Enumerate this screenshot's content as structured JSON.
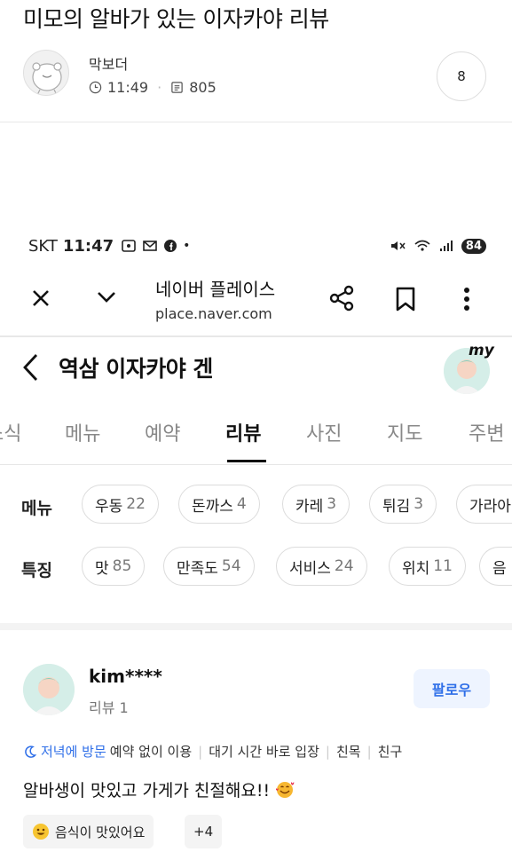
{
  "post": {
    "title": "미모의 알바가 있는 이자카야 리뷰",
    "author": "막보더",
    "time": "11:49",
    "views": "805",
    "comments": "8"
  },
  "status_bar": {
    "carrier": "SKT",
    "time": "11:47",
    "battery": "84"
  },
  "browser": {
    "title": "네이버 플레이스",
    "url": "place.naver.com"
  },
  "place": {
    "name": "역삼 이자카야 겐",
    "my_label": "my"
  },
  "tabs": [
    {
      "label": "소식"
    },
    {
      "label": "메뉴"
    },
    {
      "label": "예약"
    },
    {
      "label": "리뷰"
    },
    {
      "label": "사진"
    },
    {
      "label": "지도"
    },
    {
      "label": "주변"
    }
  ],
  "filters": {
    "menu_label": "메뉴",
    "menu_chips": [
      {
        "name": "우동",
        "count": "22"
      },
      {
        "name": "돈까스",
        "count": "4"
      },
      {
        "name": "카레",
        "count": "3"
      },
      {
        "name": "튀김",
        "count": "3"
      },
      {
        "name": "가라아",
        "count": ""
      }
    ],
    "feature_label": "특징",
    "feature_chips": [
      {
        "name": "맛",
        "count": "85"
      },
      {
        "name": "만족도",
        "count": "54"
      },
      {
        "name": "서비스",
        "count": "24"
      },
      {
        "name": "위치",
        "count": "11"
      },
      {
        "name": "음",
        "count": ""
      }
    ]
  },
  "review": {
    "user": "kim****",
    "reviews": "리뷰 1",
    "follow": "팔로우",
    "visit_time": "저녁에 방문",
    "tags": [
      "예약 없이 이용",
      "대기 시간 바로 입장",
      "친목",
      "친구"
    ],
    "text": "알바생이 맛있고 가게가 친절해요!!",
    "keyword": "음식이 맛있어요",
    "more": "+4"
  }
}
